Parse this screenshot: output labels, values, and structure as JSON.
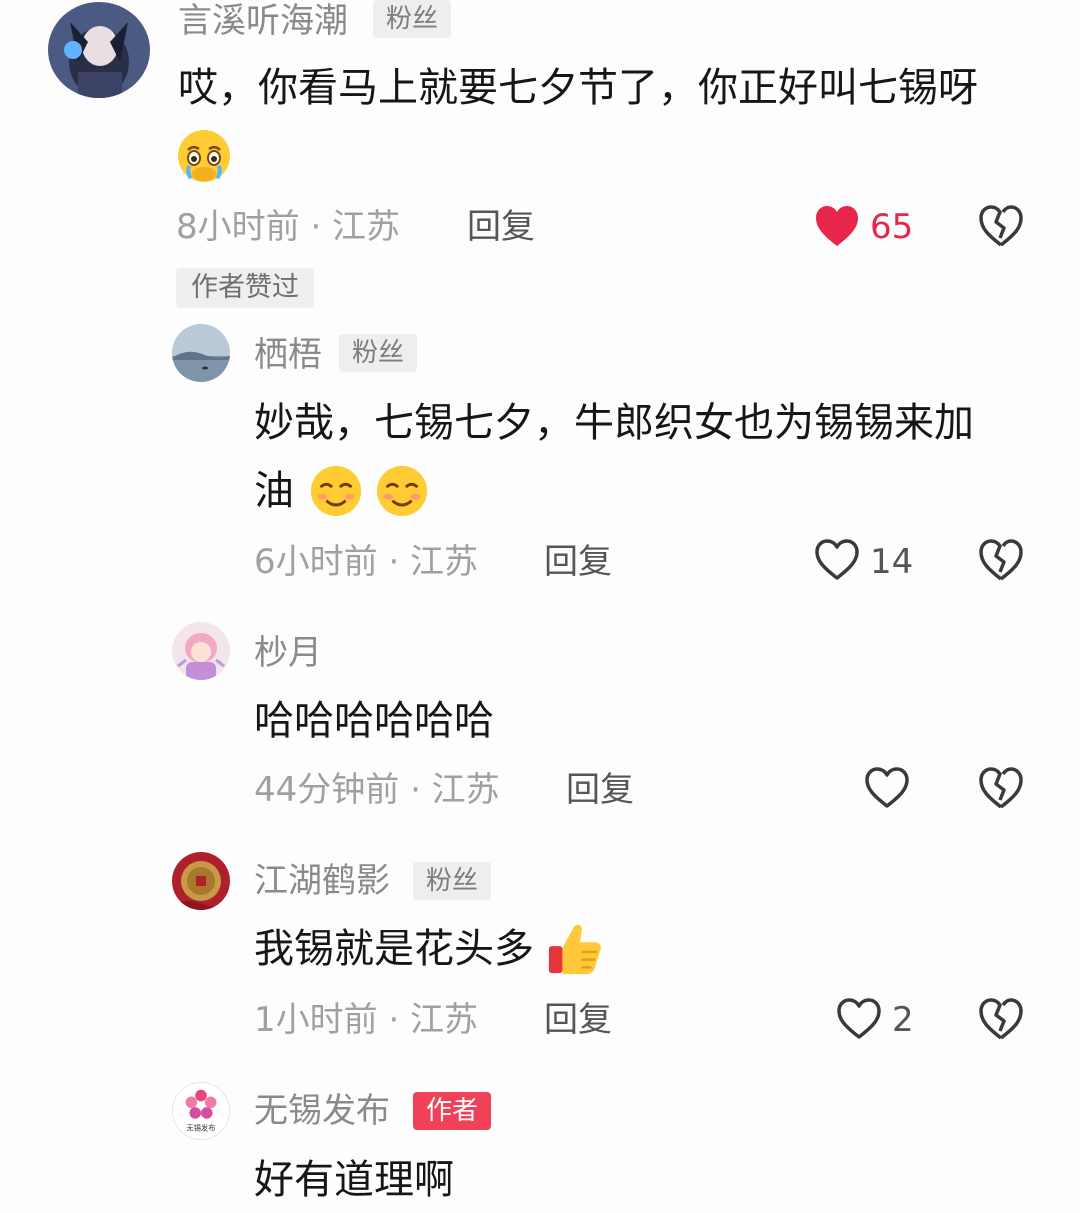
{
  "accent_color": "#e8264b",
  "comments": [
    {
      "username": "言溪听海潮",
      "badge": "粉丝",
      "text_lines": [
        "哎，你看马上就要七夕节了，你正好叫七锡呀"
      ],
      "emoji": "crying-face-emoji",
      "time": "8小时前 · 江苏",
      "reply_label": "回复",
      "likes": "65",
      "liked": true,
      "author_liked_tag": "作者赞过"
    },
    {
      "username": "栖梧",
      "badge": "粉丝",
      "text_lines": [
        "妙哉，七锡七夕，牛郎织女也为锡锡来加",
        "油"
      ],
      "emoji": "smiling-face-emoji",
      "time": "6小时前 · 江苏",
      "reply_label": "回复",
      "likes": "14",
      "liked": false
    },
    {
      "username": "杪月",
      "text_lines": [
        "哈哈哈哈哈哈"
      ],
      "time": "44分钟前 · 江苏",
      "reply_label": "回复",
      "liked": false
    },
    {
      "username": "江湖鹤影",
      "badge": "粉丝",
      "text_lines": [
        "我锡就是花头多"
      ],
      "emoji": "thumbs-up-emoji",
      "time": "1小时前 · 江苏",
      "reply_label": "回复",
      "likes": "2",
      "liked": false
    },
    {
      "username": "无锡发布",
      "badge": "作者",
      "avatar_text": "无锡发布",
      "text_lines": [
        "好有道理啊"
      ]
    }
  ]
}
